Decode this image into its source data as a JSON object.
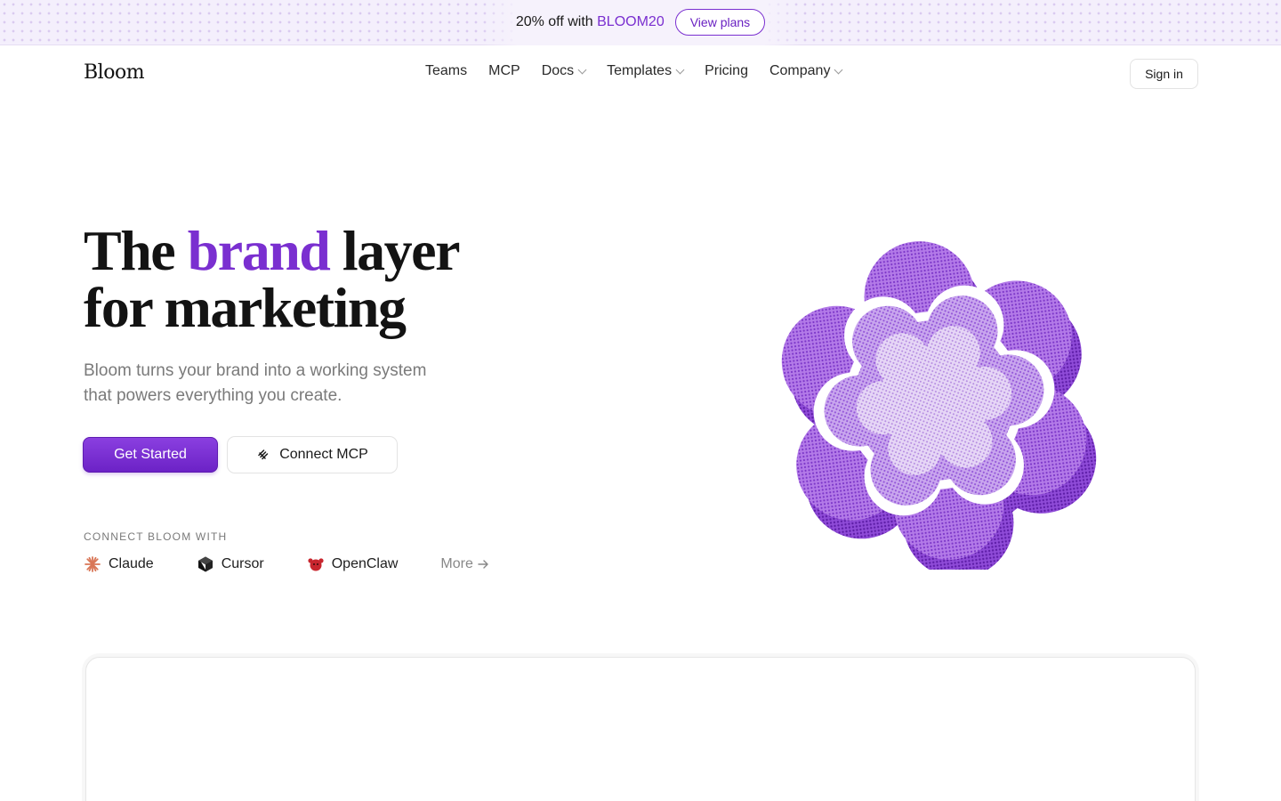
{
  "promo": {
    "text_prefix": "20% off with ",
    "code": "BLOOM20",
    "button_label": "View plans"
  },
  "nav": {
    "logo": "Bloom",
    "links": [
      {
        "label": "Teams",
        "has_dropdown": false
      },
      {
        "label": "MCP",
        "has_dropdown": false
      },
      {
        "label": "Docs",
        "has_dropdown": true
      },
      {
        "label": "Templates",
        "has_dropdown": true
      },
      {
        "label": "Pricing",
        "has_dropdown": false
      },
      {
        "label": "Company",
        "has_dropdown": true
      }
    ],
    "signin_label": "Sign in"
  },
  "hero": {
    "headline_word1": "The ",
    "headline_accent": "brand",
    "headline_word2": " layer",
    "headline_line2": "for marketing",
    "subtitle": "Bloom turns your brand into a working system that powers everything you create.",
    "primary_cta": "Get Started",
    "secondary_cta": "Connect MCP",
    "connect_label": "CONNECT BLOOM WITH",
    "integrations": [
      {
        "label": "Claude",
        "icon": "claude-icon"
      },
      {
        "label": "Cursor",
        "icon": "cursor-icon"
      },
      {
        "label": "OpenClaw",
        "icon": "openclaw-icon"
      }
    ],
    "more_label": "More"
  },
  "colors": {
    "accent": "#7a2fd0",
    "primary_button": "#7b2fd6",
    "promo_bg": "#f4effc",
    "art": "#9b5ce0"
  }
}
